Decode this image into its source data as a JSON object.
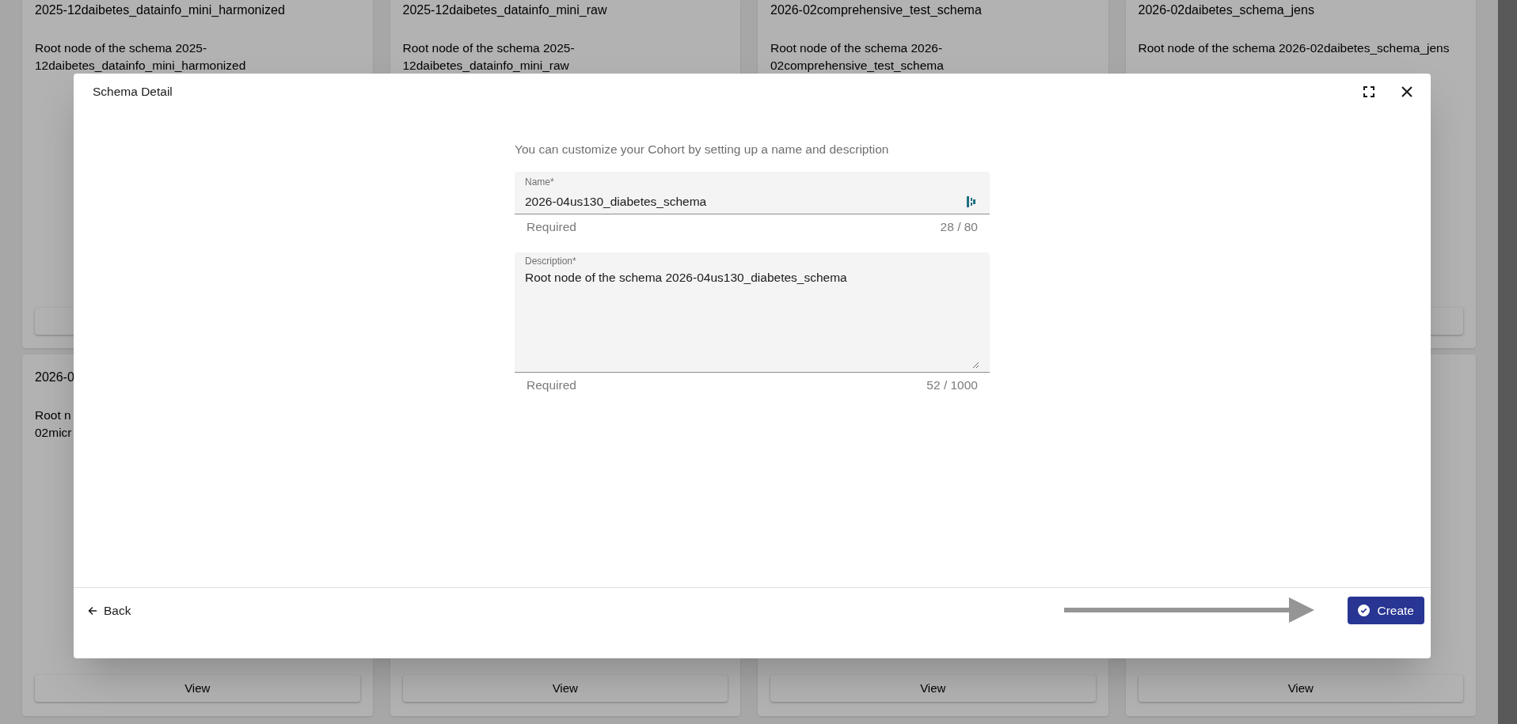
{
  "cards": [
    {
      "title": "2025-12daibetes_datainfo_mini_harmonized",
      "description": "Root node of the schema 2025-12daibetes_datainfo_mini_harmonized",
      "has_button": true
    },
    {
      "title": "2025-12daibetes_datainfo_mini_raw",
      "description": "Root node of the schema 2025-12daibetes_datainfo_mini_raw"
    },
    {
      "title": "2026-02comprehensive_test_schema",
      "description": "Root node of the schema 2026-02comprehensive_test_schema"
    },
    {
      "title": "2026-02daibetes_schema_jens",
      "description": "Root node of the schema 2026-02daibetes_schema_jens",
      "has_button": true
    },
    {
      "title": "2026-0",
      "description_lines": [
        "Root n",
        "02micr"
      ],
      "button": "View"
    },
    {
      "button": "View"
    },
    {
      "button": "View"
    },
    {
      "button": "View"
    }
  ],
  "dialog": {
    "title": "Schema Detail",
    "intro": "You can customize your Cohort by setting up a name and description",
    "name_field": {
      "label": "Name*",
      "value": "2026-04us130_diabetes_schema",
      "helper": "Required",
      "count": "28 / 80"
    },
    "description_field": {
      "label": "Description*",
      "value": "Root node of the schema 2026-04us130_diabetes_schema",
      "helper": "Required",
      "count": "52 / 1000"
    },
    "back_button": "Back",
    "create_button": "Create"
  }
}
